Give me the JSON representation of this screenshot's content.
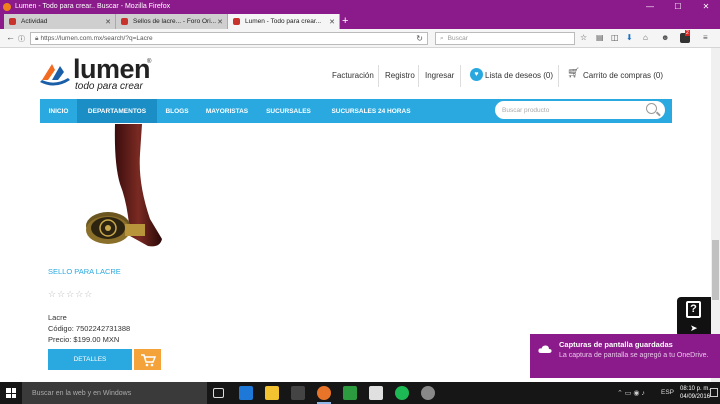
{
  "window": {
    "title": "Lumen - Todo para crear.. Buscar - Mozilla Firefox",
    "controls": [
      "—",
      "☐",
      "✕"
    ]
  },
  "tabs": [
    {
      "label": "Actividad",
      "active": false
    },
    {
      "label": "Sellos de lacre... - Foro Ori...",
      "active": false
    },
    {
      "label": "Lumen - Todo para crear...",
      "active": true
    }
  ],
  "new_tab_label": "+",
  "navbar": {
    "url": "https://lumen.com.mx/search/?q=Lacre",
    "search_placeholder": "Buscar",
    "icons": [
      "star-icon",
      "bookmarks-icon",
      "pocket-icon",
      "download-icon",
      "home-icon",
      "chat-icon",
      "addon-icon",
      "menu-icon"
    ],
    "addon_badge": "2"
  },
  "site": {
    "logo_word": "lumen",
    "logo_reg": "®",
    "logo_tagline": "todo para crear",
    "header_links": {
      "facturacion": "Facturación",
      "registro": "Registro",
      "ingresar": "Ingresar",
      "wishlist": "Lista de deseos (0)",
      "cart": "Carrito de compras (0)"
    },
    "nav": [
      "INICIO",
      "DEPARTAMENTOS",
      "BLOGS",
      "MAYORISTAS",
      "SUCURSALES",
      "SUCURSALES 24 HORAS"
    ],
    "nav_active": "DEPARTAMENTOS",
    "search_placeholder": "Buscar producto",
    "brand_color": "#2aa9e0",
    "cart_btn_color": "#f4a23a"
  },
  "product": {
    "name": "SELLO PARA LACRE",
    "stars": "☆☆☆☆☆",
    "category": "Lacre",
    "code": "Código: 7502242731388",
    "price": "Precio: $199.00 MXN",
    "details_button": "DETALLES"
  },
  "toast": {
    "title": "Capturas de pantalla guardadas",
    "body": "La captura de pantalla se agregó a tu OneDrive."
  },
  "taskbar": {
    "search_placeholder": "Buscar en la web y en Windows",
    "lang": "ESP",
    "time": "08:10 p. m.",
    "date": "04/09/2016"
  }
}
